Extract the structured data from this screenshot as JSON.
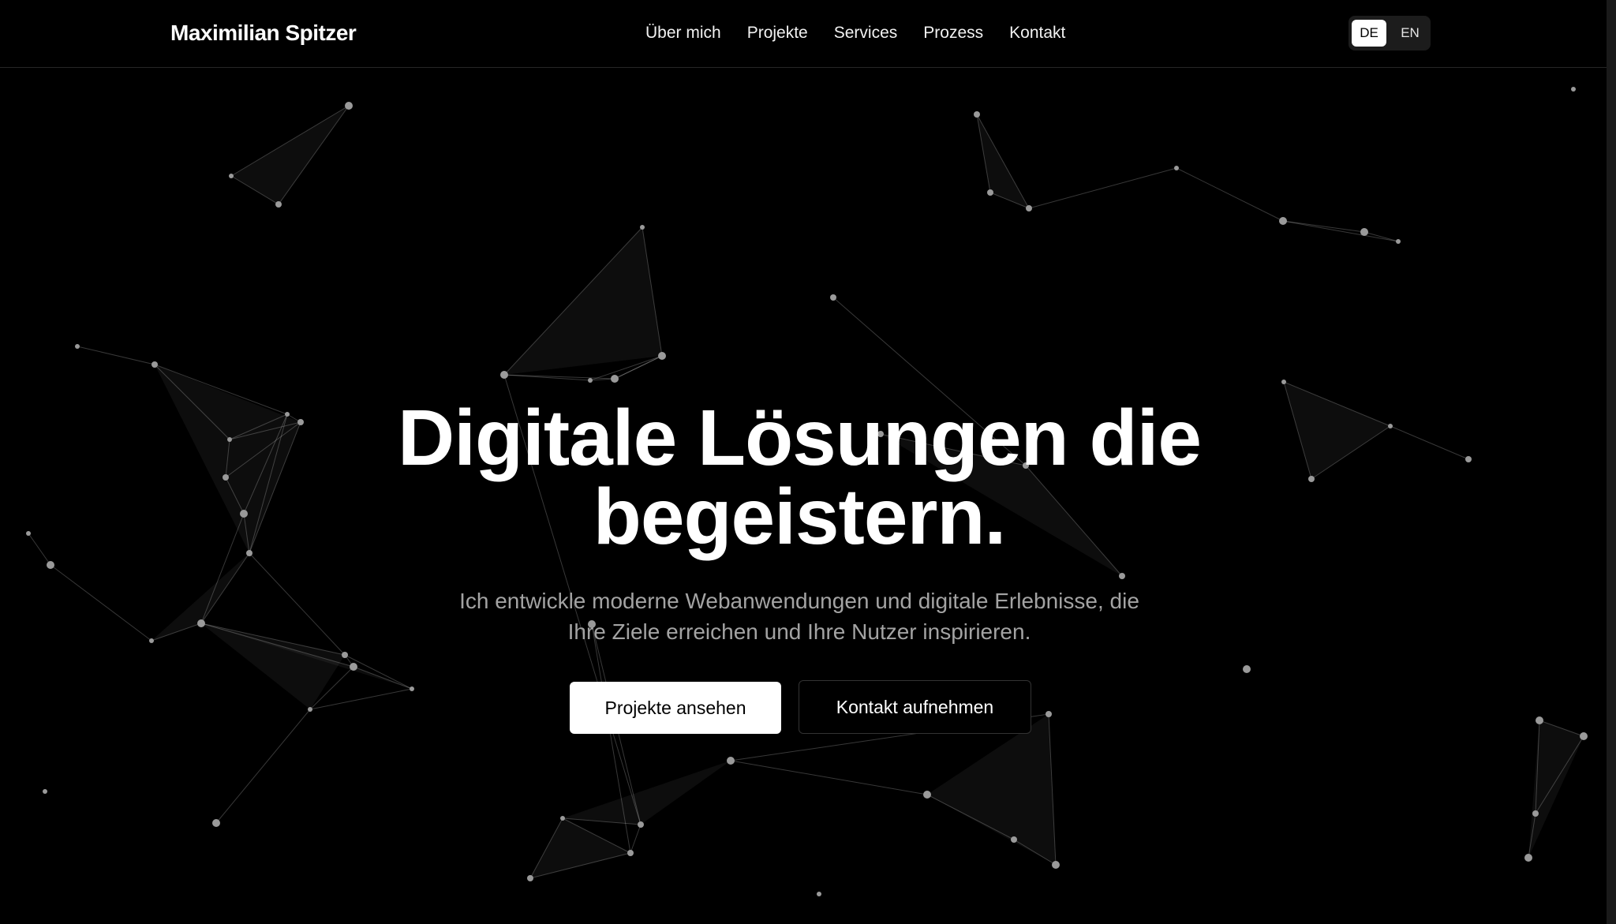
{
  "header": {
    "brand": "Maximilian Spitzer",
    "nav": [
      "Über mich",
      "Projekte",
      "Services",
      "Prozess",
      "Kontakt"
    ],
    "languages": {
      "active": "DE",
      "inactive": "EN"
    }
  },
  "hero": {
    "title_line1": "Digitale Lösungen die",
    "title_line2": "begeistern.",
    "subtitle_line1": "Ich entwickle moderne Webanwendungen und digitale Erlebnisse, die",
    "subtitle_line2": "Ihre Ziele erreichen und Ihre Nutzer inspirieren.",
    "primary_cta": "Projekte ansehen",
    "secondary_cta": "Kontakt aufnehmen"
  },
  "colors": {
    "background": "#000000",
    "text": "#ffffff",
    "muted_text": "#a3a3a3",
    "node": "#9a9a9a"
  }
}
